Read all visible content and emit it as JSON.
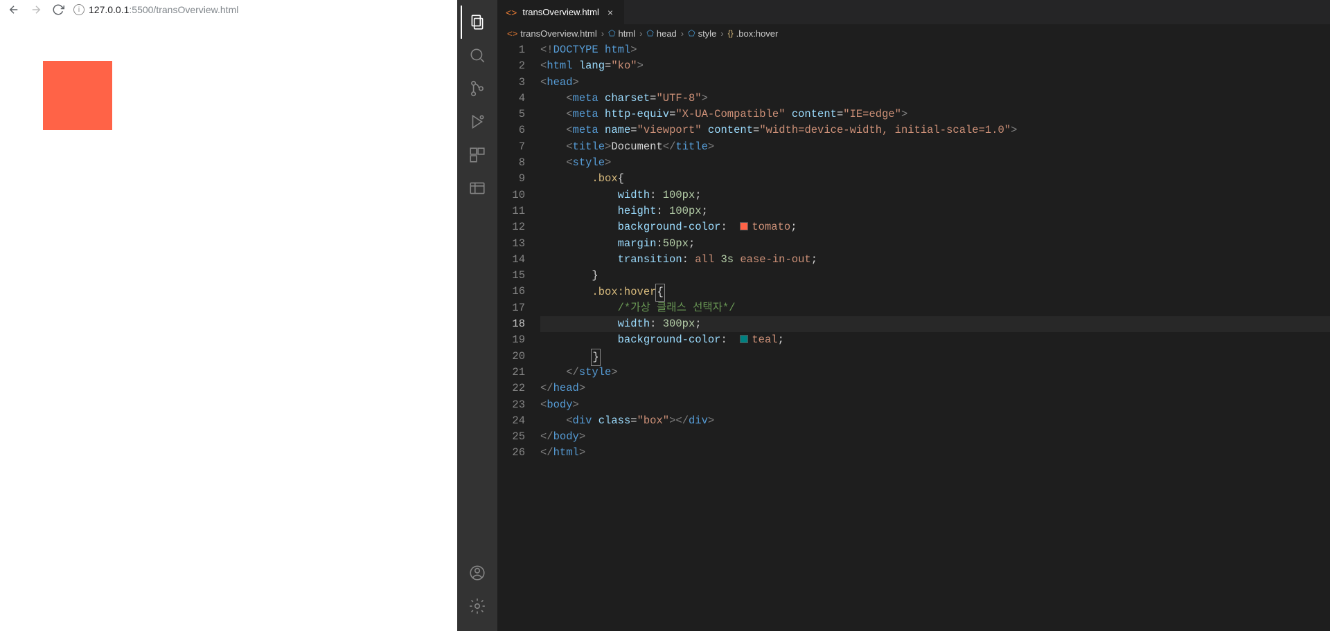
{
  "browser": {
    "url_host": "127.0.0.1",
    "url_port_path": ":5500/transOverview.html"
  },
  "vscode": {
    "tab": {
      "label": "transOverview.html"
    },
    "breadcrumb": {
      "file": "transOverview.html",
      "html": "html",
      "head": "head",
      "style": "style",
      "selector": ".box:hover"
    },
    "code": {
      "lines": [
        "1",
        "2",
        "3",
        "4",
        "5",
        "6",
        "7",
        "8",
        "9",
        "10",
        "11",
        "12",
        "13",
        "14",
        "15",
        "16",
        "17",
        "18",
        "19",
        "20",
        "21",
        "22",
        "23",
        "24",
        "25",
        "26"
      ],
      "l1": {
        "a": "<!",
        "b": "DOCTYPE ",
        "c": "html",
        "d": ">"
      },
      "l2": {
        "a": "<",
        "b": "html ",
        "c": "lang",
        "d": "=",
        "e": "\"ko\"",
        "f": ">"
      },
      "l3": {
        "a": "<",
        "b": "head",
        "c": ">"
      },
      "l4": {
        "a": "<",
        "b": "meta ",
        "c": "charset",
        "d": "=",
        "e": "\"UTF-8\"",
        "f": ">"
      },
      "l5": {
        "a": "<",
        "b": "meta ",
        "c": "http-equiv",
        "d": "=",
        "e": "\"X-UA-Compatible\"",
        "f": " ",
        "g": "content",
        "h": "=",
        "i": "\"IE=edge\"",
        "j": ">"
      },
      "l6": {
        "a": "<",
        "b": "meta ",
        "c": "name",
        "d": "=",
        "e": "\"viewport\"",
        "f": " ",
        "g": "content",
        "h": "=",
        "i": "\"width=device-width, initial-scale=1.0\"",
        "j": ">"
      },
      "l7": {
        "a": "<",
        "b": "title",
        "c": ">",
        "d": "Document",
        "e": "</",
        "f": "title",
        "g": ">"
      },
      "l8": {
        "a": "<",
        "b": "style",
        "c": ">"
      },
      "l9": {
        "a": ".box",
        "b": "{"
      },
      "l10": {
        "a": "width",
        "b": ": ",
        "c": "100px",
        "d": ";"
      },
      "l11": {
        "a": "height",
        "b": ": ",
        "c": "100px",
        "d": ";"
      },
      "l12": {
        "a": "background-color",
        "b": ": ",
        "c": "tomato",
        "d": ";"
      },
      "l13": {
        "a": "margin",
        "b": ":",
        "c": "50px",
        "d": ";"
      },
      "l14": {
        "a": "transition",
        "b": ": ",
        "c": "all ",
        "d": "3s ",
        "e": "ease-in-out",
        "f": ";"
      },
      "l15": {
        "a": "}"
      },
      "l16": {
        "a": ".box:hover",
        "b": "{"
      },
      "l17": {
        "a": "/*가상 클래스 선택자*/"
      },
      "l18": {
        "a": "width",
        "b": ": ",
        "c": "300px",
        "d": ";"
      },
      "l19": {
        "a": "background-color",
        "b": ": ",
        "c": "teal",
        "d": ";"
      },
      "l20": {
        "a": "}"
      },
      "l21": {
        "a": "</",
        "b": "style",
        "c": ">"
      },
      "l22": {
        "a": "</",
        "b": "head",
        "c": ">"
      },
      "l23": {
        "a": "<",
        "b": "body",
        "c": ">"
      },
      "l24": {
        "a": "<",
        "b": "div ",
        "c": "class",
        "d": "=",
        "e": "\"box\"",
        "f": "></",
        "g": "div",
        "h": ">"
      },
      "l25": {
        "a": "</",
        "b": "body",
        "c": ">"
      },
      "l26": {
        "a": "</",
        "b": "html",
        "c": ">"
      }
    }
  }
}
